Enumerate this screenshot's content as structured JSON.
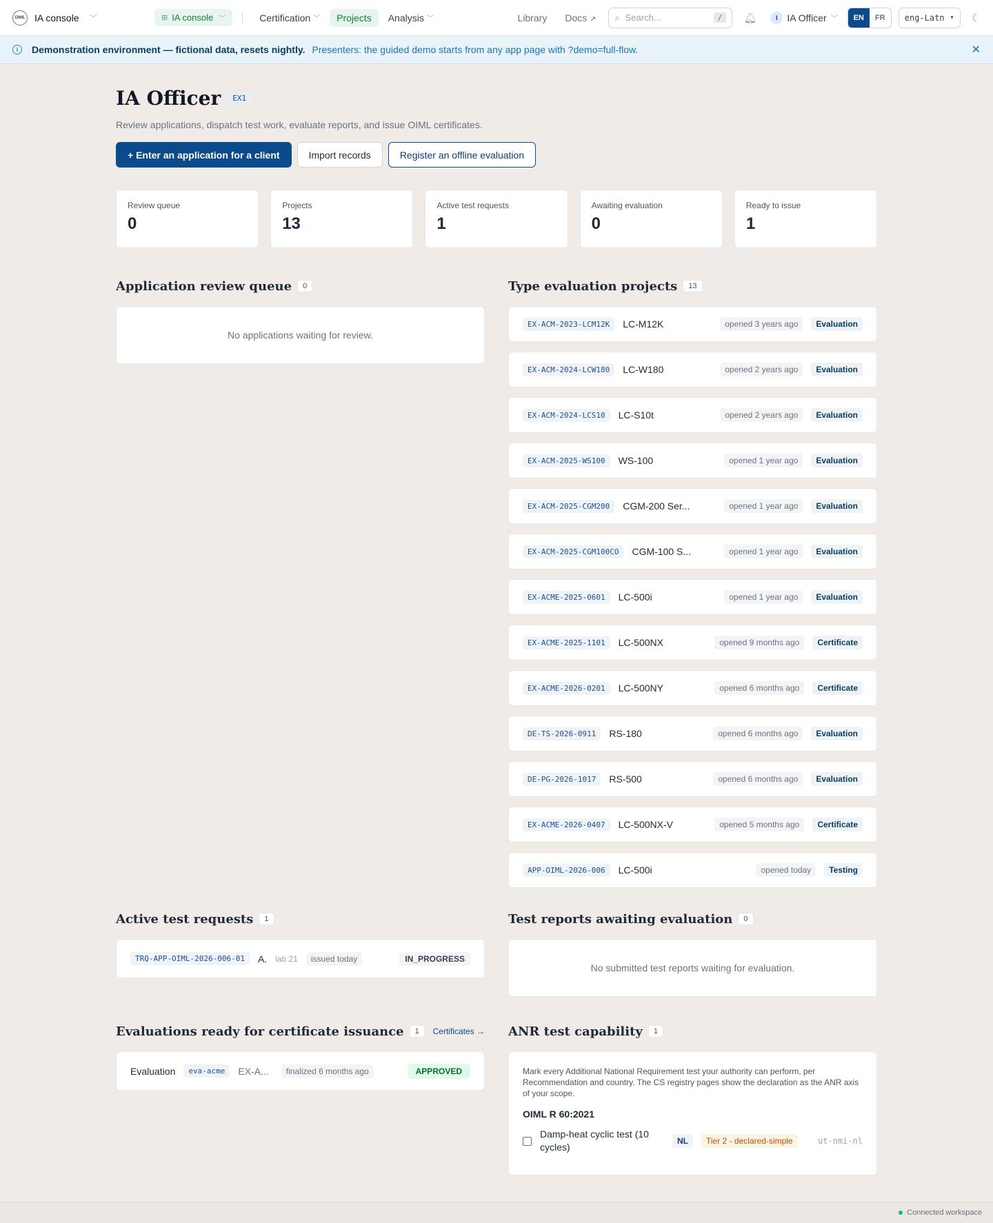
{
  "nav": {
    "brand": "IA console",
    "logo_text": "OIML",
    "console_pill": "IA console",
    "links": [
      "Certification",
      "Projects",
      "Analysis"
    ],
    "library": "Library",
    "docs": "Docs",
    "search_placeholder": "Search...",
    "search_kbd": "/",
    "user": "IA Officer",
    "user_initial": "I",
    "lang": [
      "EN",
      "FR"
    ],
    "script": "eng-Latn"
  },
  "banner": {
    "strong": "Demonstration environment — fictional data, resets nightly.",
    "text": "Presenters: the guided demo starts from any app page with ?demo=full-flow."
  },
  "page": {
    "title": "IA Officer",
    "code": "EX1",
    "subtitle": "Review applications, dispatch test work, evaluate reports, and issue OIML certificates.",
    "actions": [
      "+ Enter an application for a client",
      "Import records",
      "Register an offline evaluation"
    ]
  },
  "stats": [
    {
      "label": "Review queue",
      "value": "0"
    },
    {
      "label": "Projects",
      "value": "13"
    },
    {
      "label": "Active test requests",
      "value": "1"
    },
    {
      "label": "Awaiting evaluation",
      "value": "0"
    },
    {
      "label": "Ready to issue",
      "value": "1"
    }
  ],
  "review_queue": {
    "title": "Application review queue",
    "count": "0",
    "empty": "No applications waiting for review."
  },
  "projects": {
    "title": "Type evaluation projects",
    "count": "13",
    "items": [
      {
        "id": "EX-ACM-2023-LCM12K",
        "name": "LC-M12K",
        "opened": "opened 3 years ago",
        "stage": "Evaluation"
      },
      {
        "id": "EX-ACM-2024-LCW180",
        "name": "LC-W180",
        "opened": "opened 2 years ago",
        "stage": "Evaluation"
      },
      {
        "id": "EX-ACM-2024-LCS10",
        "name": "LC-S10t",
        "opened": "opened 2 years ago",
        "stage": "Evaluation"
      },
      {
        "id": "EX-ACM-2025-WS100",
        "name": "WS-100",
        "opened": "opened 1 year ago",
        "stage": "Evaluation"
      },
      {
        "id": "EX-ACM-2025-CGM200",
        "name": "CGM-200 Ser...",
        "opened": "opened 1 year ago",
        "stage": "Evaluation"
      },
      {
        "id": "EX-ACM-2025-CGM100CO",
        "name": "CGM-100 S...",
        "opened": "opened 1 year ago",
        "stage": "Evaluation"
      },
      {
        "id": "EX-ACME-2025-0601",
        "name": "LC-500i",
        "opened": "opened 1 year ago",
        "stage": "Evaluation"
      },
      {
        "id": "EX-ACME-2025-1101",
        "name": "LC-500NX",
        "opened": "opened 9 months ago",
        "stage": "Certificate"
      },
      {
        "id": "EX-ACME-2026-0201",
        "name": "LC-500NY",
        "opened": "opened 6 months ago",
        "stage": "Certificate"
      },
      {
        "id": "DE-TS-2026-0911",
        "name": "RS-180",
        "opened": "opened 6 months ago",
        "stage": "Evaluation"
      },
      {
        "id": "DE-PG-2026-1017",
        "name": "RS-500",
        "opened": "opened 6 months ago",
        "stage": "Evaluation"
      },
      {
        "id": "EX-ACME-2026-0407",
        "name": "LC-500NX-V",
        "opened": "opened 5 months ago",
        "stage": "Certificate"
      },
      {
        "id": "APP-OIML-2026-006",
        "name": "LC-500i",
        "opened": "opened today",
        "stage": "Testing"
      }
    ]
  },
  "test_requests": {
    "title": "Active test requests",
    "count": "1",
    "item": {
      "id": "TRQ-APP-OIML-2026-006-01",
      "name": "A.",
      "lab": "lab 21",
      "issued": "issued today",
      "status": "IN_PROGRESS"
    }
  },
  "reports": {
    "title": "Test reports awaiting evaluation",
    "count": "0",
    "empty": "No submitted test reports waiting for evaluation."
  },
  "ready": {
    "title": "Evaluations ready for certificate issuance",
    "count": "1",
    "link": "Certificates →",
    "item": {
      "label": "Evaluation",
      "code": "eva-acme",
      "ref": "EX-A...",
      "finalized": "finalized 6 months ago",
      "status": "APPROVED"
    }
  },
  "anr": {
    "title": "ANR test capability",
    "count": "1",
    "desc": "Mark every Additional National Requirement test your authority can perform, per Recommendation and country. The CS registry pages show the declaration as the ANR axis of your scope.",
    "recommendation": "OIML R 60:2021",
    "test": {
      "name": "Damp-heat cyclic test (10 cycles)",
      "country": "NL",
      "tier": "Tier 2 - declared-simple",
      "org": "ut-nmi-nl"
    }
  },
  "footer": {
    "status": "Connected workspace"
  }
}
